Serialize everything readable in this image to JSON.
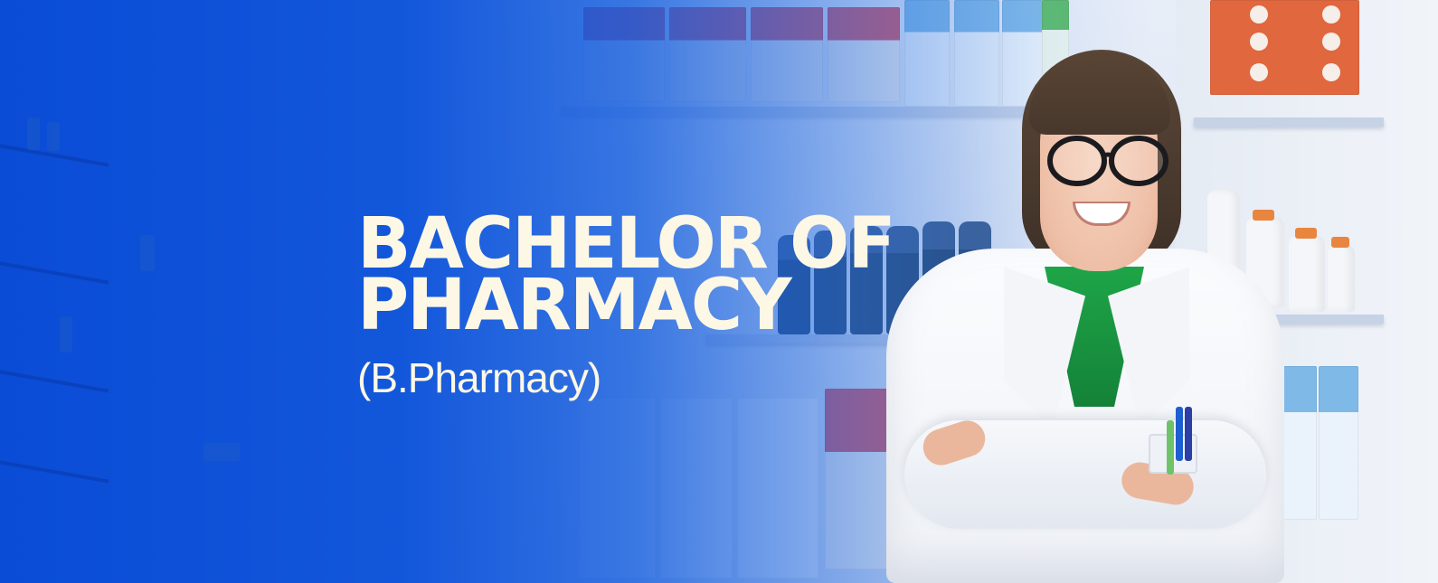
{
  "banner": {
    "title_line_1": "BACHELOR OF",
    "title_line_2": "PHARMACY",
    "subtitle": "(B.Pharmacy)"
  },
  "colors": {
    "overlay_blue": "#0b4fd6",
    "headline_text": "#fdf7e6",
    "scrub_shirt": "#1ea548",
    "lab_coat": "#f3f5f9"
  },
  "imagery": {
    "subject": "pharmacist-woman-in-lab-coat",
    "background": "pharmacy-shelves"
  }
}
